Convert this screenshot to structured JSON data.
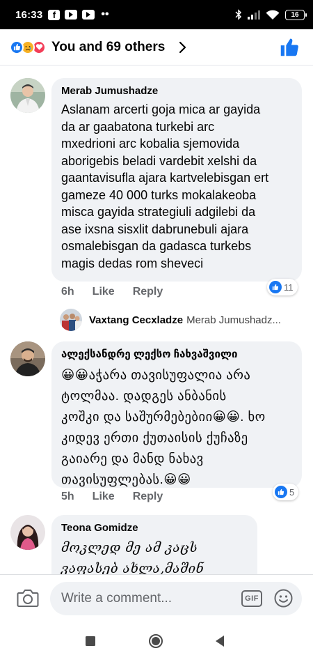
{
  "status_bar": {
    "time": "16:33",
    "battery": "16",
    "extra": "••"
  },
  "header": {
    "reactions_summary": "You and 69 others",
    "reaction_icons": [
      "like-icon",
      "sad-icon",
      "love-icon"
    ]
  },
  "comments": [
    {
      "name": "Merab Jumushadze",
      "text": "Aslanam arcerti goja mica ar gayida\nda ar gaabatona turkebi arc\nmxedrioni arc kobalia sjemovida\naborigebis beladi vardebit xelshi da\ngaantavisufla ajara kartvelebisgan ert\ngameze 40 000 turks mokalakeoba\nmisca gayida strategiuli adgilebi da\nase ixsna sisxlit dabrunebuli ajara\nosmalebisgan da gadasca turkebs\nmagis dedas rom sheveci",
      "time": "6h",
      "like": "Like",
      "reply": "Reply",
      "reactions": "11"
    },
    {
      "name": "ალექსანდრე ლექსო ჩახვაშვილი",
      "text": "😀😀აჭარა თავისუფალია არა\nტოლმაა. დადგეს ანბანის\nკოშკი და საშურმებებიი😀😀. ხო\nკიდევ ერთი ქუთაისის ქუჩაზე\nგაიარე და მანდ ნახავ\nთავისუფლებას.😀😀",
      "time": "5h",
      "like": "Like",
      "reply": "Reply",
      "reactions": "5"
    },
    {
      "name": "Teona Gomidze",
      "text": "მოკლედ მე ამ კაცს\nვაფასებ ახლა,მაშინ"
    }
  ],
  "reply_preview": {
    "name": "Vaxtang Cecxladze",
    "text": "Merab Jumushadz..."
  },
  "composer": {
    "placeholder": "Write a comment...",
    "gif_label": "GIF"
  },
  "colors": {
    "facebook_blue": "#1877f2",
    "bubble_gray": "#f0f2f5",
    "secondary_text": "#65676b"
  }
}
